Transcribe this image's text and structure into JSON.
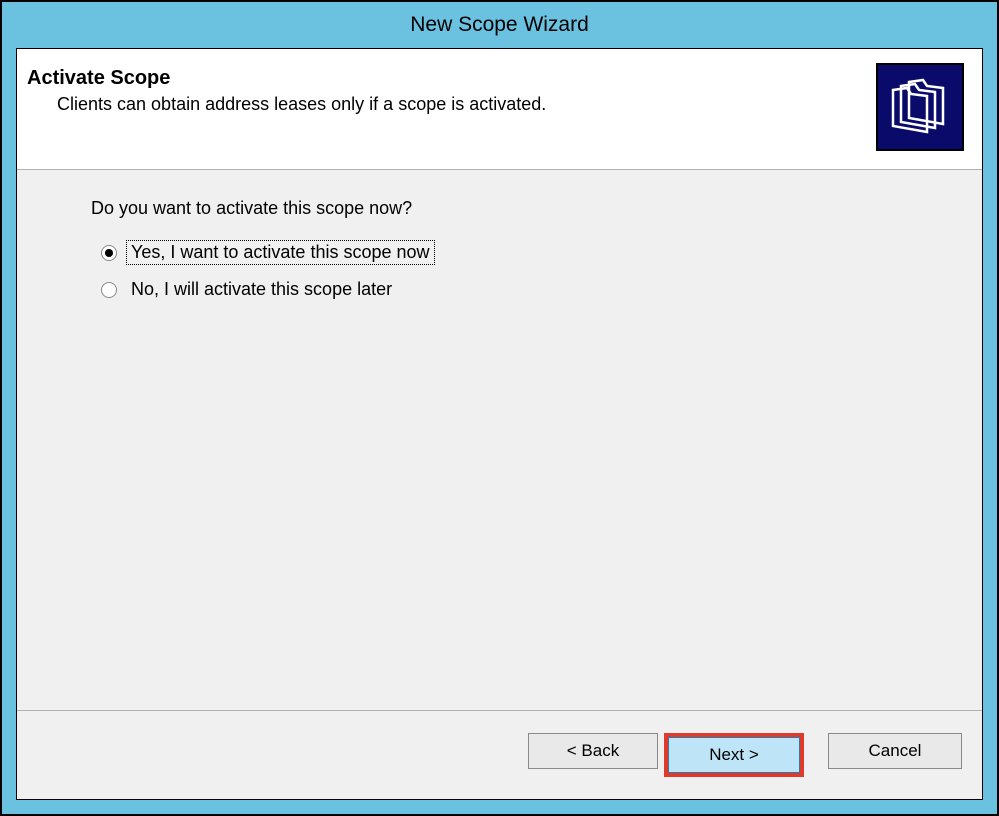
{
  "window": {
    "title": "New Scope Wizard"
  },
  "header": {
    "title": "Activate Scope",
    "subtitle": "Clients can obtain address leases only if a scope is activated."
  },
  "content": {
    "question": "Do you want to activate this scope now?",
    "options": {
      "yes": "Yes, I want to activate this scope now",
      "no": "No, I will activate this scope later"
    }
  },
  "footer": {
    "back": "< Back",
    "next": "Next >",
    "cancel": "Cancel"
  }
}
